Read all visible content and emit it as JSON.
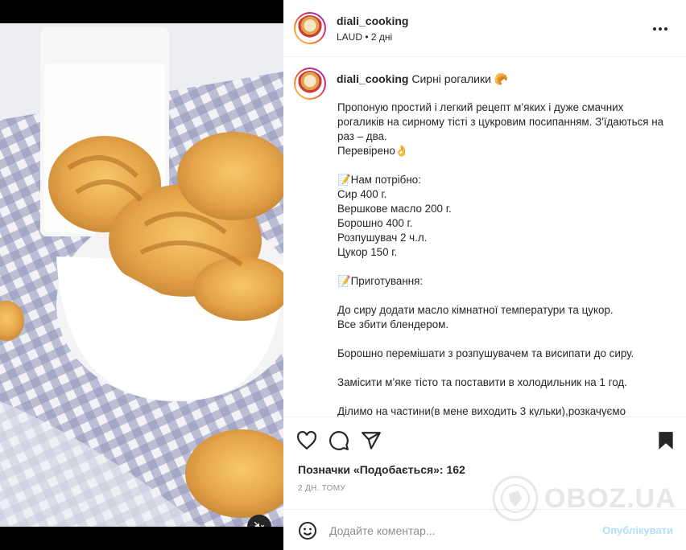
{
  "post": {
    "username": "diali_cooking",
    "location": "LAUD",
    "posted_ago": "• 2 дні",
    "caption_title": "Сирні рогалики 🥐",
    "caption_lines": [
      "Пропоную простий і легкий рецепт м’яких і дуже смачних рогаликів на сирному тісті з цукровим посипанням. З'їдаються на раз – два.",
      "Перевірено👌",
      "",
      "📝Нам потрібно:",
      "Сир 400 г.",
      "Вершкове масло 200 г.",
      "Борошно 400 г.",
      "Розпушувач 2 ч.л.",
      "Цукор 150 г.",
      "",
      "📝Приготування:",
      "",
      "До сиру додати масло кімнатної температури та цукор.",
      "Все збити блендером.",
      "",
      "Борошно перемішати з розпушувачем та висипати до сиру.",
      "",
      "Замісити м’яке тісто та поставити в холодильник на 1 год.",
      "",
      "Ділимо на частини(в мене виходить 3 кульки),розкачуємо"
    ],
    "likes": "Позначки «Подобається»: 162",
    "timestamp": "2 ДН. ТОМУ"
  },
  "comment": {
    "placeholder": "Додайте коментар...",
    "publish_label": "Опублікувати"
  },
  "watermark": {
    "text": "OBOZ.UA"
  },
  "icons": {
    "more": "more-horizontal-icon",
    "like": "heart-icon",
    "comment": "comment-icon",
    "share": "send-icon",
    "save": "bookmark-icon",
    "emoji": "emoji-icon",
    "play": "play-icon",
    "mute": "muted-speaker-icon"
  },
  "colors": {
    "publish_disabled": "#b2dffc",
    "muted_text": "#8e8e8e",
    "text": "#262626"
  }
}
